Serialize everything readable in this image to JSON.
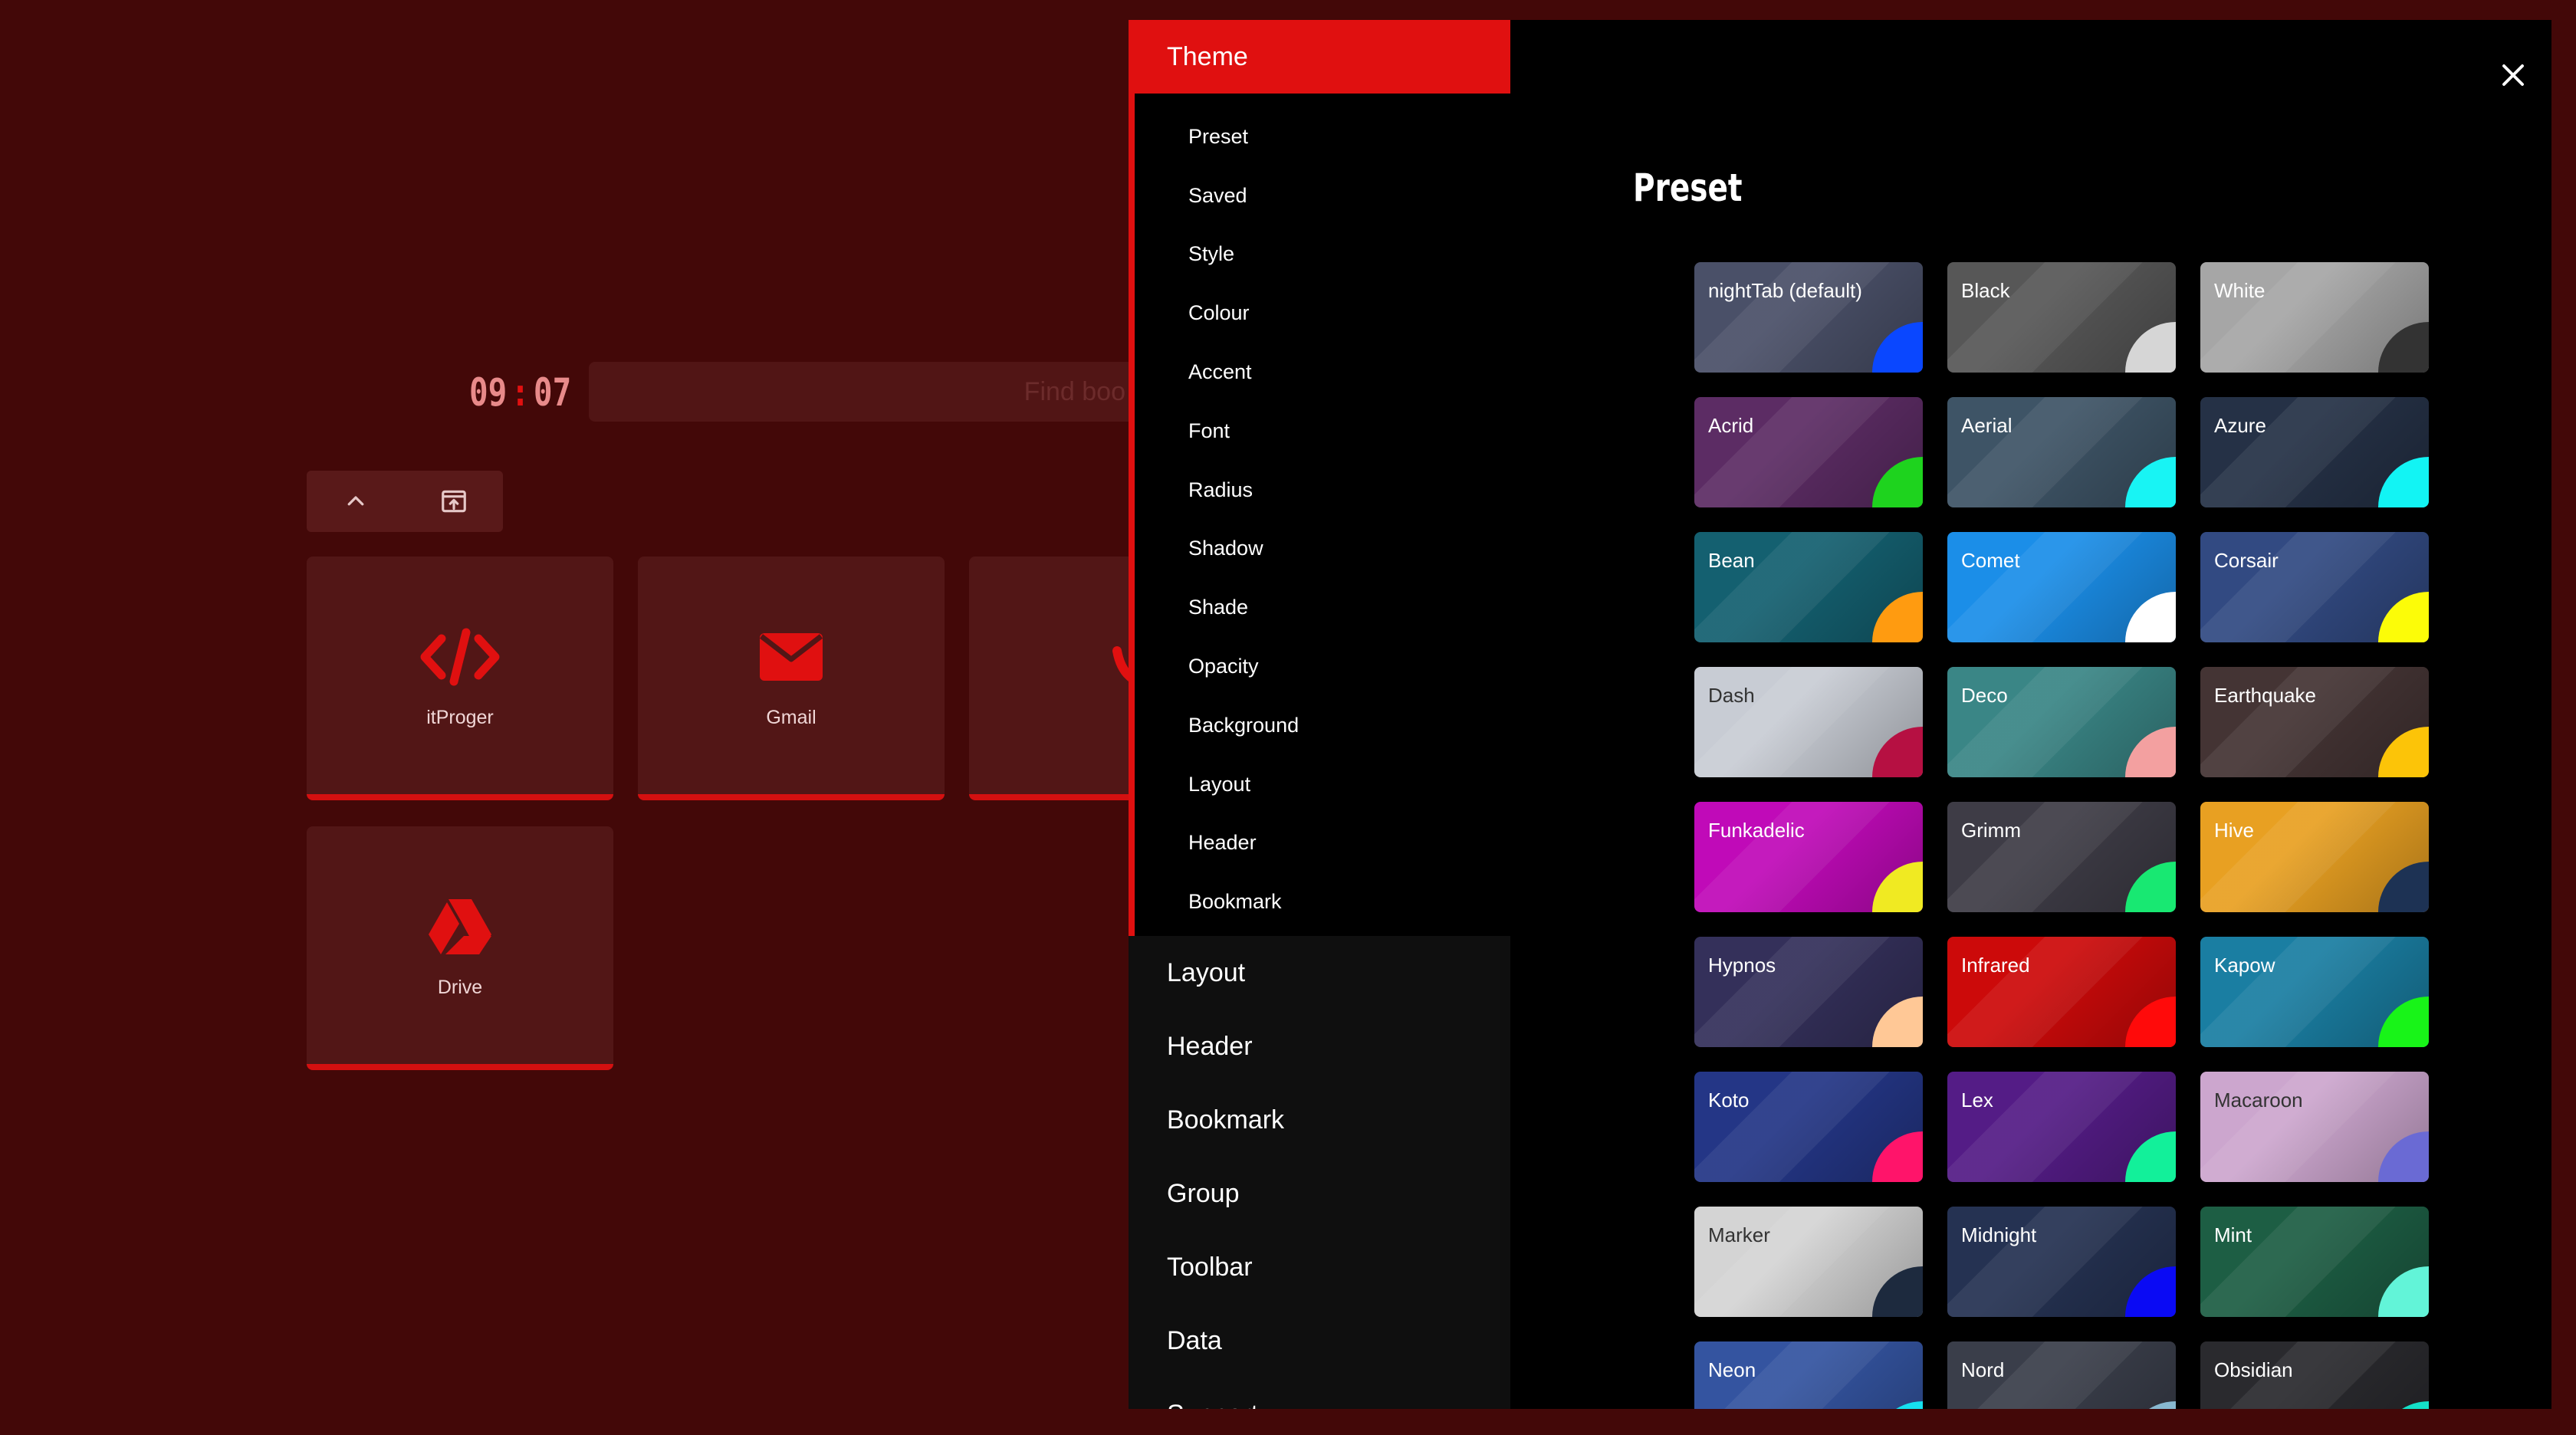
{
  "clock": {
    "hours": "09",
    "separator": ":",
    "minutes": "07"
  },
  "search": {
    "placeholder": "Find boo"
  },
  "bookmarks": [
    {
      "label": "itProger",
      "icon": "code-icon"
    },
    {
      "label": "Gmail",
      "icon": "mail-icon"
    },
    {
      "label": "",
      "icon": "partial-icon"
    },
    {
      "label": "Drive",
      "icon": "drive-icon"
    }
  ],
  "menu": {
    "active_section": "Theme",
    "sub_items": [
      "Preset",
      "Saved",
      "Style",
      "Colour",
      "Accent",
      "Font",
      "Radius",
      "Shadow",
      "Shade",
      "Opacity",
      "Background",
      "Layout",
      "Header",
      "Bookmark"
    ],
    "sections": [
      "Layout",
      "Header",
      "Bookmark",
      "Group",
      "Toolbar",
      "Data",
      "Support"
    ],
    "content_title": "Preset"
  },
  "presets": [
    {
      "name": "nightTab (default)",
      "bg": "#4a5068",
      "accent": "#0a47ff",
      "text": "#ffffff"
    },
    {
      "name": "Black",
      "bg": "#575757",
      "accent": "#d6d6d6",
      "text": "#ffffff"
    },
    {
      "name": "White",
      "bg": "#a6a6a6",
      "accent": "#333333",
      "text": "#ffffff"
    },
    {
      "name": "Acrid",
      "bg": "#5c2c64",
      "accent": "#1ed31e",
      "text": "#ffffff"
    },
    {
      "name": "Aerial",
      "bg": "#3e5466",
      "accent": "#18f4f4",
      "text": "#ffffff"
    },
    {
      "name": "Azure",
      "bg": "#253146",
      "accent": "#12f4f4",
      "text": "#ffffff"
    },
    {
      "name": "Bean",
      "bg": "#146070",
      "accent": "#ff9b10",
      "text": "#ffffff"
    },
    {
      "name": "Comet",
      "bg": "#1b8ee8",
      "accent": "#ffffff",
      "text": "#ffffff"
    },
    {
      "name": "Corsair",
      "bg": "#324a82",
      "accent": "#fcfc08",
      "text": "#ffffff"
    },
    {
      "name": "Dash",
      "bg": "#c8ccd4",
      "accent": "#b61042",
      "text": "#333333"
    },
    {
      "name": "Deco",
      "bg": "#3a8686",
      "accent": "#f3a0a0",
      "text": "#ffffff"
    },
    {
      "name": "Earthquake",
      "bg": "#443434",
      "accent": "#fcc408",
      "text": "#ffffff"
    },
    {
      "name": "Funkadelic",
      "bg": "#c00ab8",
      "accent": "#f0ea22",
      "text": "#ffffff"
    },
    {
      "name": "Grimm",
      "bg": "#3e3c46",
      "accent": "#18e872",
      "text": "#ffffff"
    },
    {
      "name": "Hive",
      "bg": "#e8a022",
      "accent": "#1d3254",
      "text": "#ffffff"
    },
    {
      "name": "Hypnos",
      "bg": "#34305a",
      "accent": "#ffc896",
      "text": "#ffffff"
    },
    {
      "name": "Infrared",
      "bg": "#cc0a0a",
      "accent": "#ff0a0a",
      "text": "#ffffff"
    },
    {
      "name": "Kapow",
      "bg": "#1a7ea2",
      "accent": "#18f418",
      "text": "#ffffff"
    },
    {
      "name": "Koto",
      "bg": "#243686",
      "accent": "#ff146a",
      "text": "#ffffff"
    },
    {
      "name": "Lex",
      "bg": "#541c86",
      "accent": "#12f09a",
      "text": "#ffffff"
    },
    {
      "name": "Macaroon",
      "bg": "#cca6ce",
      "accent": "#6a6ad4",
      "text": "#333333"
    },
    {
      "name": "Marker",
      "bg": "#d4d4d4",
      "accent": "#1d2a3e",
      "text": "#333333"
    },
    {
      "name": "Midnight",
      "bg": "#253252",
      "accent": "#0a0af4",
      "text": "#ffffff"
    },
    {
      "name": "Mint",
      "bg": "#1d5e44",
      "accent": "#62f4d8",
      "text": "#ffffff"
    },
    {
      "name": "Neon",
      "bg": "#3454a0",
      "accent": "#16e0f0",
      "text": "#ffffff"
    },
    {
      "name": "Nord",
      "bg": "#3a3e4a",
      "accent": "#88b8d0",
      "text": "#ffffff"
    },
    {
      "name": "Obsidian",
      "bg": "#2a2a2e",
      "accent": "#14e0c8",
      "text": "#ffffff"
    }
  ],
  "colors": {
    "page_bg": "#430808",
    "accent": "#e01010",
    "tile_bg": "#521616",
    "menu_bg": "#000000",
    "nav_bg": "#0f0f0f"
  }
}
